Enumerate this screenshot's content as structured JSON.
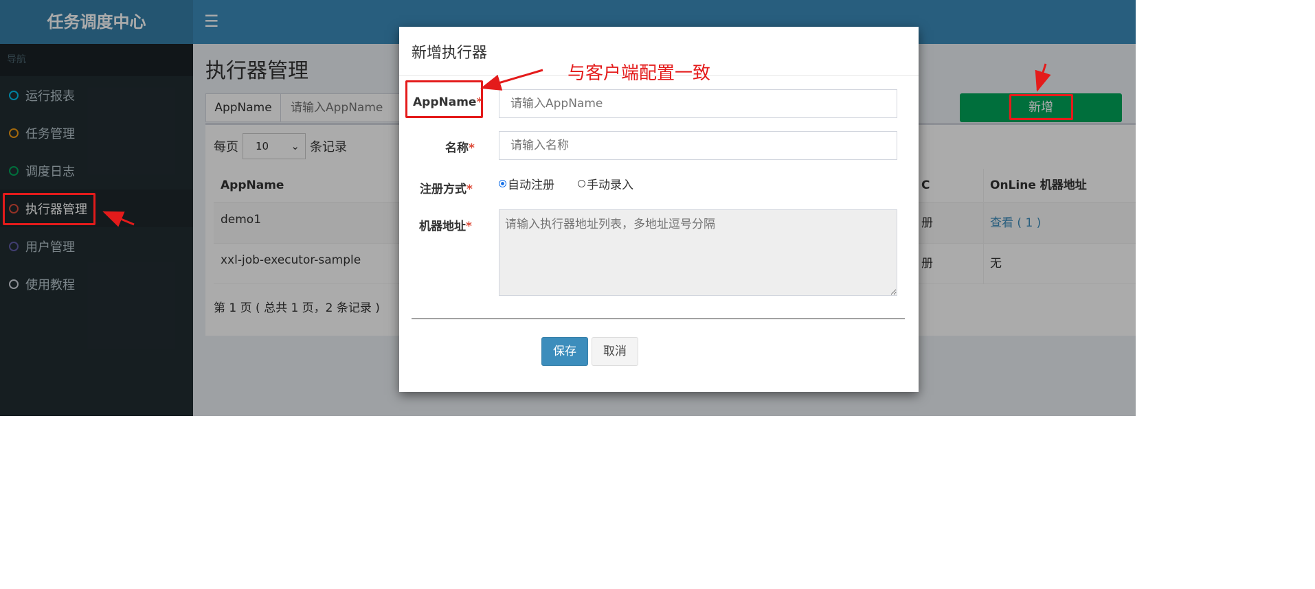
{
  "app": {
    "brand": "任务调度中心",
    "menu_icon": "hamburger-icon",
    "sidebar": {
      "header": "导航",
      "items": [
        {
          "label": "运行报表",
          "color": "#00c0ef",
          "active": false
        },
        {
          "label": "任务管理",
          "color": "#f39c12",
          "active": false
        },
        {
          "label": "调度日志",
          "color": "#00a65a",
          "active": false
        },
        {
          "label": "执行器管理",
          "color": "#dd4b39",
          "active": true
        },
        {
          "label": "用户管理",
          "color": "#605ca8",
          "active": false
        },
        {
          "label": "使用教程",
          "color": "#d2d6de",
          "active": false
        }
      ]
    }
  },
  "page": {
    "title": "执行器管理",
    "search": {
      "addon_label": "AppName",
      "placeholder": "请输入AppName"
    },
    "add_button": "新增",
    "length": {
      "prefix": "每页",
      "value": "10",
      "suffix": "条记录"
    },
    "table": {
      "headers": {
        "appname": "AppName",
        "partial": "C",
        "online": "OnLine 机器地址"
      },
      "rows": [
        {
          "appname": "demo1",
          "partial": "册",
          "online": "查看 ( 1 )",
          "online_is_link": true
        },
        {
          "appname": "xxl-job-executor-sample",
          "partial": "册",
          "online": "无",
          "online_is_link": false
        }
      ]
    },
    "pager": "第 1 页 ( 总共 1 页，2 条记录 )"
  },
  "modal": {
    "title": "新增执行器",
    "required_mark": "*",
    "fields": {
      "appname": {
        "label": "AppName",
        "placeholder": "请输入AppName"
      },
      "name": {
        "label": "名称",
        "placeholder": "请输入名称"
      },
      "register_type": {
        "label": "注册方式",
        "options": [
          "自动注册",
          "手动录入"
        ],
        "selected": "自动注册"
      },
      "address": {
        "label": "机器地址",
        "placeholder": "请输入执行器地址列表，多地址逗号分隔"
      }
    },
    "save_button": "保存",
    "cancel_button": "取消"
  },
  "annotation": {
    "text": "与客户端配置一致",
    "color": "#e41b1b"
  }
}
